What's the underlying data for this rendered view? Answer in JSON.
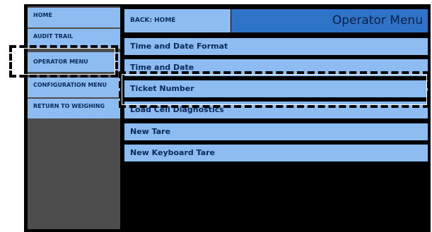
{
  "sidebar": {
    "items": [
      {
        "label": "HOME"
      },
      {
        "label": "AUDIT TRAIL"
      },
      {
        "label": "OPERATOR MENU"
      },
      {
        "label": "CONFIGURATION MENU"
      },
      {
        "label": "RETURN TO WEIGHING"
      }
    ]
  },
  "header": {
    "back_label": "BACK: HOME",
    "title": "Operator Menu"
  },
  "menu": {
    "items": [
      {
        "label": "Time and Date Format"
      },
      {
        "label": "Time and Date"
      },
      {
        "label": "Ticket Number"
      },
      {
        "label": "Load Cell Diagnostics"
      },
      {
        "label": "New Tare"
      },
      {
        "label": "New Keyboard Tare"
      }
    ]
  },
  "colors": {
    "button_fill": "#8dbcf2",
    "title_fill": "#2e73c7",
    "sidebar_fill": "#4d4d4d",
    "background": "#000000",
    "text": "#0b2a5a"
  }
}
